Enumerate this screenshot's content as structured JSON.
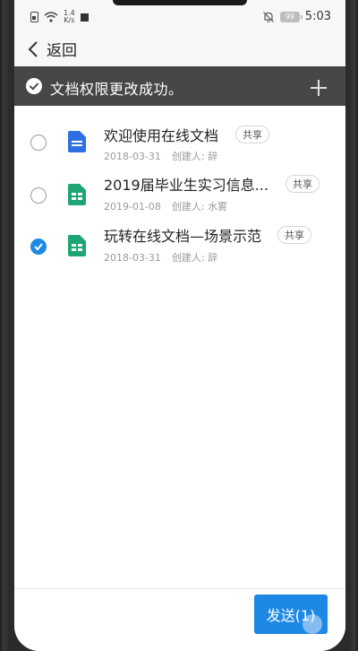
{
  "status_bar": {
    "speed_value": "1.4",
    "speed_unit": "K/s",
    "battery": "99",
    "time": "5:03"
  },
  "nav": {
    "back_label": "返回"
  },
  "toast": {
    "message": "文档权限更改成功。"
  },
  "documents": [
    {
      "title": "欢迎使用在线文档",
      "share": "共享",
      "date": "2018-03-31",
      "creator": "创建人: 辞",
      "type": "doc",
      "selected": false
    },
    {
      "title": "2019届毕业生实习信息...",
      "share": "共享",
      "date": "2019-01-08",
      "creator": "创建人: 水雾",
      "type": "sheet",
      "selected": false
    },
    {
      "title": "玩转在线文档—场景示范",
      "share": "共享",
      "date": "2018-03-31",
      "creator": "创建人: 辞",
      "type": "sheet",
      "selected": true
    }
  ],
  "send_button": {
    "label": "发送(1)"
  },
  "colors": {
    "accent": "#1e88e5",
    "doc_blue": "#2f6fe4",
    "sheet_green": "#1ea672",
    "toast_bg": "#474747"
  },
  "icons": [
    "sim-icon",
    "wifi-icon",
    "bell-off-icon",
    "battery-icon",
    "back-chevron-icon",
    "check-circle-icon",
    "plus-icon",
    "doc-icon",
    "sheet-icon",
    "radio-icon"
  ]
}
